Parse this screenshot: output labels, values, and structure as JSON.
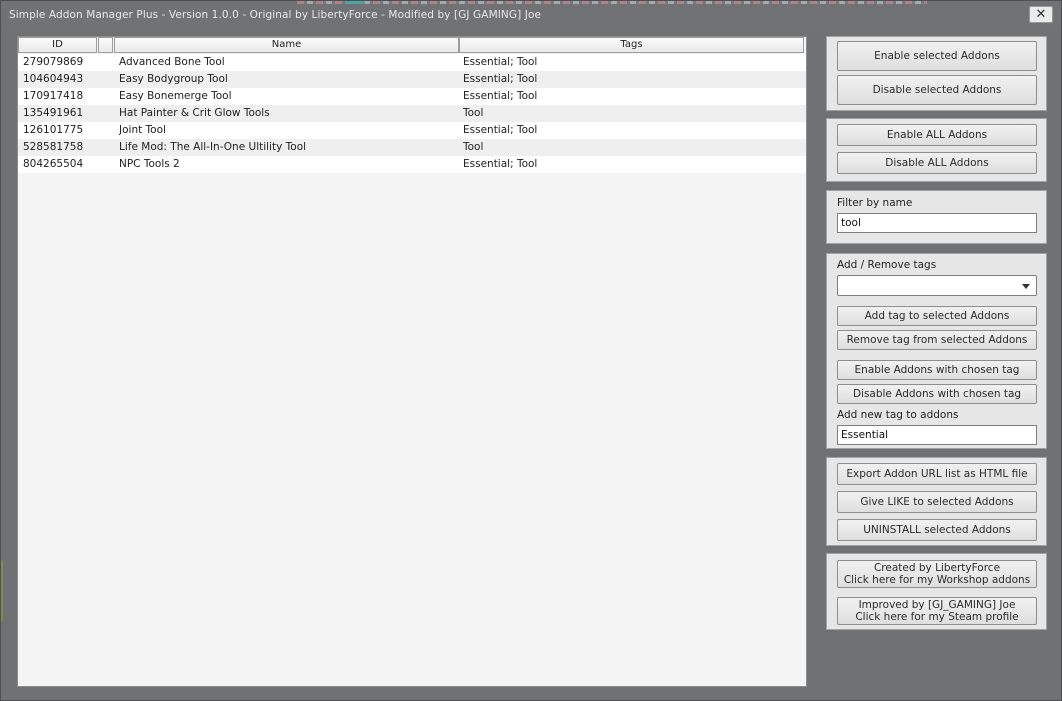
{
  "window": {
    "title": "Simple Addon Manager Plus - Version 1.0.0 - Original by LibertyForce - Modified by [GJ GAMING] Joe",
    "close_glyph": "✕"
  },
  "table": {
    "columns": [
      "ID",
      "",
      "Name",
      "Tags"
    ],
    "rows": [
      {
        "id": "279079869",
        "name": "Advanced Bone Tool",
        "tags": "Essential; Tool"
      },
      {
        "id": "104604943",
        "name": "Easy Bodygroup Tool",
        "tags": "Essential; Tool"
      },
      {
        "id": "170917418",
        "name": "Easy Bonemerge Tool",
        "tags": "Essential; Tool"
      },
      {
        "id": "135491961",
        "name": "Hat Painter & Crit Glow Tools",
        "tags": "Tool"
      },
      {
        "id": "126101775",
        "name": "Joint Tool",
        "tags": "Essential; Tool"
      },
      {
        "id": "528581758",
        "name": "Life Mod: The All-In-One Ultility Tool",
        "tags": "Tool"
      },
      {
        "id": "804265504",
        "name": "NPC Tools 2",
        "tags": "Essential; Tool"
      }
    ]
  },
  "selection": {
    "enable_selected": "Enable selected Addons",
    "disable_selected": "Disable selected Addons"
  },
  "all": {
    "enable_all": "Enable ALL Addons",
    "disable_all": "Disable ALL Addons"
  },
  "filter": {
    "label": "Filter by name",
    "value": "tool"
  },
  "tags": {
    "label": "Add / Remove tags",
    "dropdown_value": "",
    "add_tag": "Add tag to selected Addons",
    "remove_tag": "Remove tag from selected Addons",
    "enable_with_tag": "Enable Addons with chosen tag",
    "disable_with_tag": "Disable Addons with chosen tag",
    "new_tag_label": "Add new tag to addons",
    "new_tag_value": "Essential"
  },
  "actions": {
    "export": "Export Addon URL list as HTML file",
    "like": "Give LIKE to selected Addons",
    "uninstall": "UNINSTALL selected Addons"
  },
  "credits": {
    "creator_line1": "Created by LibertyForce",
    "creator_line2": "Click here for my Workshop addons",
    "improver_line1": "Improved by [GJ_GAMING] Joe",
    "improver_line2": "Click here for my Steam profile"
  }
}
